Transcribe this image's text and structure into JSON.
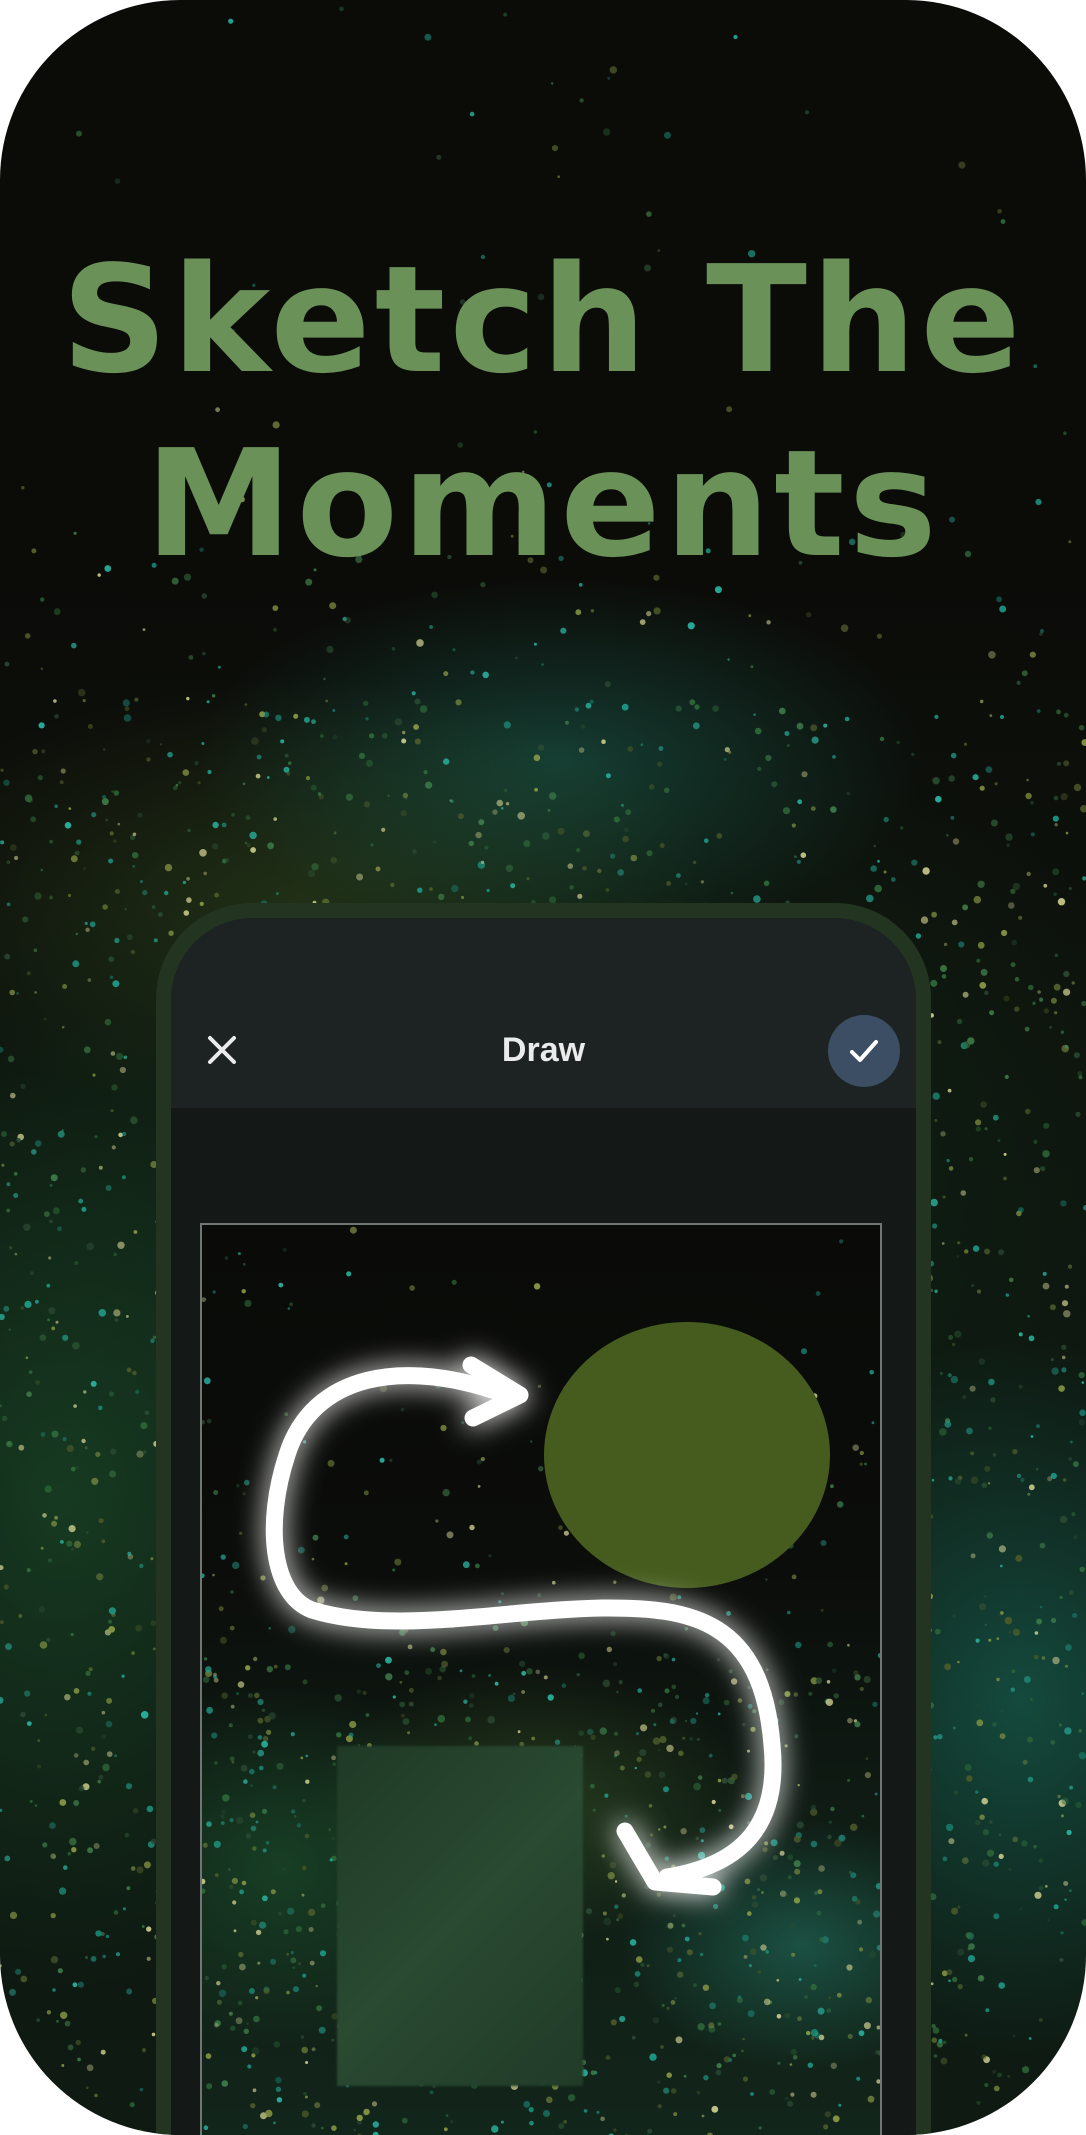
{
  "headline": {
    "line1": "Sketch The",
    "line2": "Moments"
  },
  "editor": {
    "title": "Draw",
    "close_icon": "close-icon",
    "done_icon": "checkmark-icon"
  },
  "colors": {
    "headline": "#6a9157",
    "phone_frame": "#233520",
    "navbar": "#1d2322",
    "done_button": "#3b4e63",
    "circle_sticker": "#465c1e",
    "stroke": "#ffffff"
  }
}
